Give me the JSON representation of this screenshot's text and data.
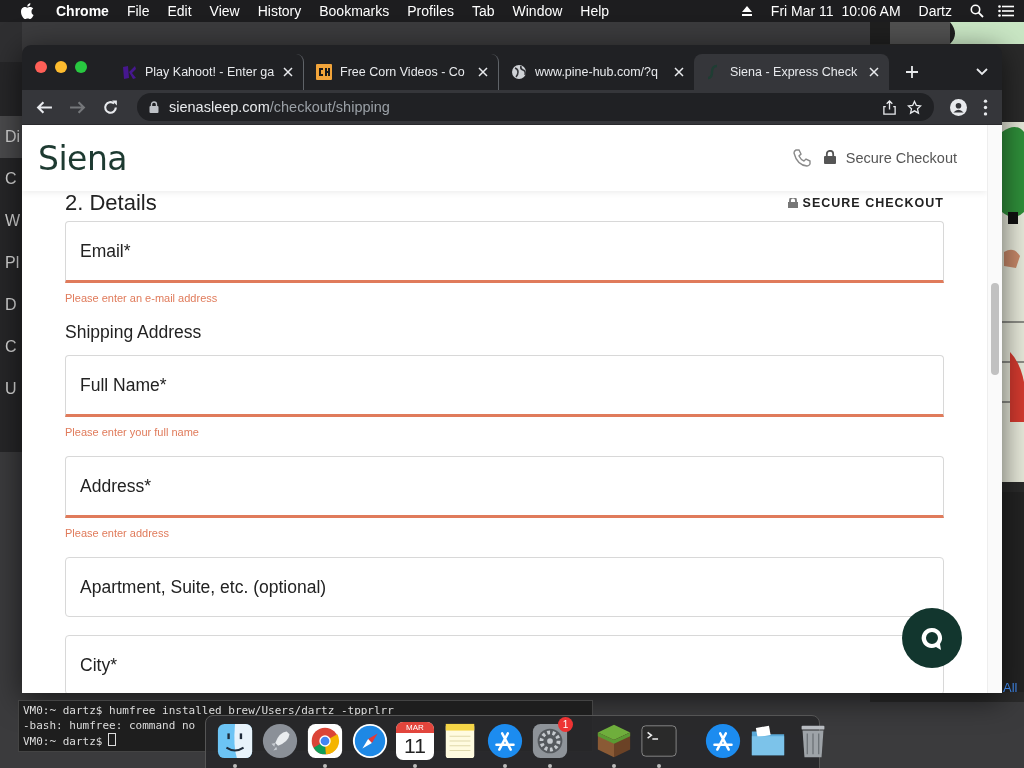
{
  "menu_bar": {
    "app": "Chrome",
    "items": [
      "File",
      "Edit",
      "View",
      "History",
      "Bookmarks",
      "Profiles",
      "Tab",
      "Window",
      "Help"
    ],
    "date": "Fri Mar 11",
    "time": "10:06 AM",
    "user": "Dartz"
  },
  "background_window": {
    "items": [
      {
        "label": "Di",
        "selected": true
      },
      {
        "label": "C",
        "selected": false
      },
      {
        "label": "W",
        "selected": false
      },
      {
        "label": "Pl",
        "selected": false
      },
      {
        "label": "D",
        "selected": false
      },
      {
        "label": "C",
        "selected": false
      },
      {
        "label": "U",
        "selected": false
      }
    ]
  },
  "right_window": {
    "link": "All"
  },
  "browser": {
    "tabs": [
      {
        "kind": "kahoot",
        "title": "Play Kahoot! - Enter ga",
        "selected": false
      },
      {
        "kind": "ch",
        "title": "Free Corn Videos - Co",
        "selected": false
      },
      {
        "kind": "globe",
        "title": "www.pine-hub.com/?q",
        "selected": false
      },
      {
        "kind": "siena",
        "title": "Siena - Express Check",
        "selected": true
      }
    ],
    "address": {
      "domain": "sienasleep.com",
      "path": "/checkout/shipping"
    },
    "page": {
      "logo": "Siena",
      "header_secure": "Secure Checkout",
      "section_title": "2. Details",
      "secure_badge": "SECURE CHECKOUT",
      "form": [
        {
          "kind": "field",
          "label": "Email*",
          "invalid": true,
          "error": "Please enter an e-mail address"
        },
        {
          "kind": "heading",
          "label": "Shipping Address"
        },
        {
          "kind": "field",
          "label": "Full Name*",
          "invalid": true,
          "error": "Please enter your full name"
        },
        {
          "kind": "field",
          "label": "Address*",
          "invalid": true,
          "error": "Please enter address"
        },
        {
          "kind": "field",
          "label": "Apartment, Suite, etc. (optional)",
          "invalid": false
        },
        {
          "kind": "field",
          "label": "City*",
          "invalid": false
        }
      ]
    }
  },
  "terminal": {
    "lines": [
      "VM0:~ dartz$ humfree installed brew/Users/dartz -tpprlrr",
      "-bash: humfree: command no",
      "VM0:~ dartz$"
    ]
  },
  "dock": [
    {
      "kind": "finder",
      "running": true
    },
    {
      "kind": "launchpad",
      "running": false
    },
    {
      "kind": "chrome",
      "running": true
    },
    {
      "kind": "safari",
      "running": false
    },
    {
      "kind": "calendar",
      "running": true,
      "month": "MAR",
      "day": "11"
    },
    {
      "kind": "notes",
      "running": false
    },
    {
      "kind": "appstore",
      "running": true
    },
    {
      "kind": "settings",
      "running": true,
      "badge": "1"
    },
    {
      "kind": "separator"
    },
    {
      "kind": "minecraft",
      "running": true
    },
    {
      "kind": "terminal",
      "running": true
    },
    {
      "kind": "separator"
    },
    {
      "kind": "appstore",
      "running": false
    },
    {
      "kind": "folder",
      "running": false
    },
    {
      "kind": "trash",
      "running": false
    }
  ]
}
